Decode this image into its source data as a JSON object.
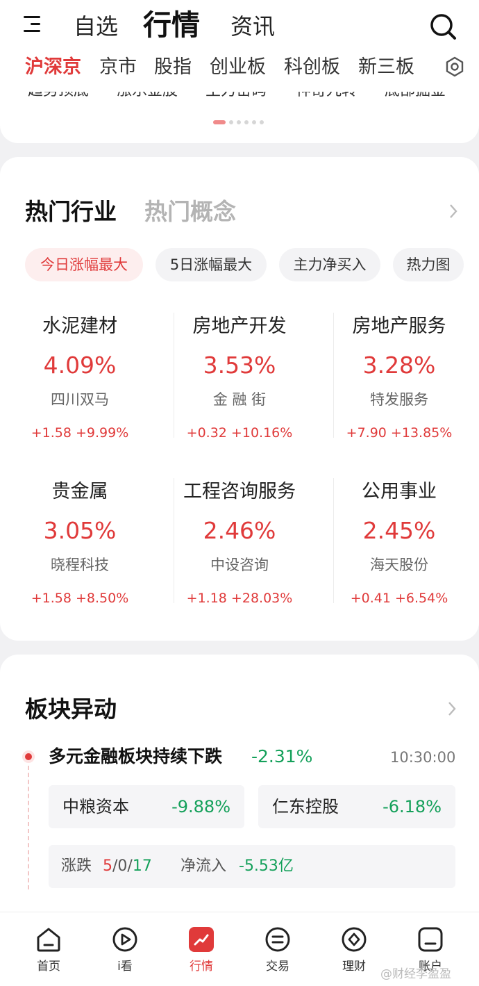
{
  "header": {
    "tabs": [
      {
        "label": "自选"
      },
      {
        "label": "行情"
      },
      {
        "label": "资讯"
      }
    ],
    "active_tab": "行情"
  },
  "subtabs": [
    {
      "label": "沪深京"
    },
    {
      "label": "京市"
    },
    {
      "label": "股指"
    },
    {
      "label": "创业板"
    },
    {
      "label": "科创板"
    },
    {
      "label": "新三板"
    }
  ],
  "signal_strip": {
    "labels": [
      "趋势顶底",
      "涨乐金股",
      "主力密码",
      "神奇九转",
      "底部掘金"
    ],
    "page_count": 6,
    "active_page": 0
  },
  "hot": {
    "titles": {
      "active": "热门行业",
      "inactive": "热门概念"
    },
    "filters": [
      {
        "label": "今日涨幅最大"
      },
      {
        "label": "5日涨幅最大"
      },
      {
        "label": "主力净买入"
      },
      {
        "label": "热力图"
      }
    ],
    "industries": [
      {
        "name": "水泥建材",
        "pct": "4.09%",
        "stock": "四川双马",
        "change": "+1.58 +9.99%"
      },
      {
        "name": "房地产开发",
        "pct": "3.53%",
        "stock": "金 融 街",
        "change": "+0.32 +10.16%"
      },
      {
        "name": "房地产服务",
        "pct": "3.28%",
        "stock": "特发服务",
        "change": "+7.90 +13.85%"
      },
      {
        "name": "贵金属",
        "pct": "3.05%",
        "stock": "晓程科技",
        "change": "+1.58 +8.50%"
      },
      {
        "name": "工程咨询服务",
        "pct": "2.46%",
        "stock": "中设咨询",
        "change": "+1.18 +28.03%"
      },
      {
        "name": "公用事业",
        "pct": "2.45%",
        "stock": "海天股份",
        "change": "+0.41 +6.54%"
      }
    ]
  },
  "movement": {
    "title": "板块异动",
    "event": {
      "title": "多元金融板块持续下跌",
      "pct": "-2.31%",
      "time": "10:30:00",
      "stocks": [
        {
          "name": "中粮资本",
          "pct": "-9.88%"
        },
        {
          "name": "仁东控股",
          "pct": "-6.18%"
        }
      ],
      "stats": {
        "updown_label": "涨跌",
        "up": "5",
        "sep": "/",
        "flat": "0",
        "down": "17",
        "flow_label": "净流入",
        "flow_value": "-5.53亿"
      }
    }
  },
  "bottom_nav": [
    {
      "label": "首页",
      "icon": "home-icon"
    },
    {
      "label": "i看",
      "icon": "play-icon"
    },
    {
      "label": "行情",
      "icon": "chart-icon"
    },
    {
      "label": "交易",
      "icon": "trade-icon"
    },
    {
      "label": "理财",
      "icon": "diamond-icon"
    },
    {
      "label": "账户",
      "icon": "account-icon"
    }
  ],
  "watermark": "@财经李盈盈",
  "colors": {
    "accent_red": "#e03a3a",
    "down_green": "#14a05a"
  }
}
